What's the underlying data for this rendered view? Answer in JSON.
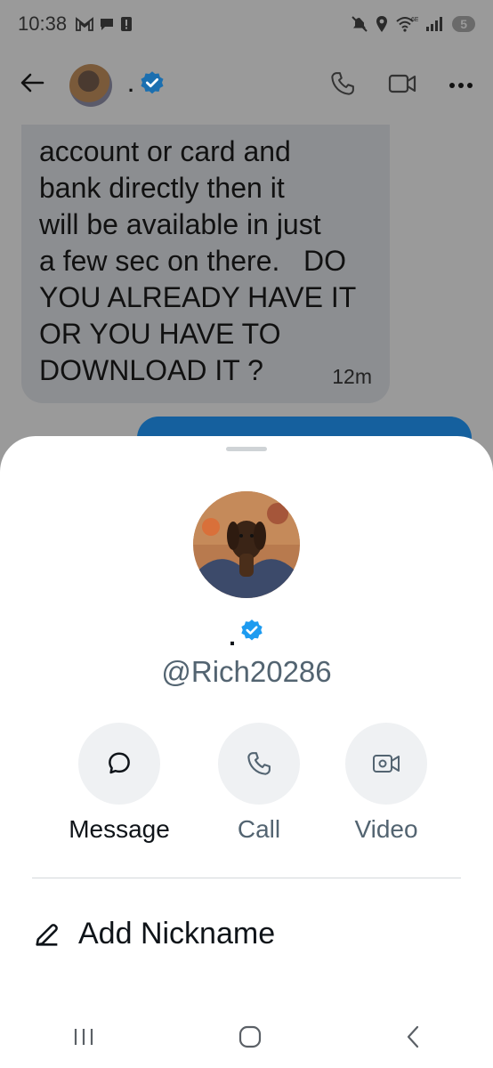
{
  "status_bar": {
    "time": "10:38",
    "left_icons": [
      "gmail-icon",
      "chat-icon",
      "alert-icon"
    ],
    "right_icons": [
      "mute-icon",
      "location-icon",
      "wifi-6e-icon",
      "signal-icon"
    ],
    "battery": "5"
  },
  "chat_header": {
    "name": ".",
    "verified": true
  },
  "message": {
    "text": "account or card and\nbank directly then it\nwill be available in just\na few sec on there.   DO\nYOU ALREADY HAVE IT\nOR YOU HAVE TO\nDOWNLOAD IT ?",
    "time": "12m"
  },
  "sheet": {
    "display_name": ".",
    "handle": "@Rich20286",
    "actions": [
      {
        "label": "Message",
        "icon": "message-icon"
      },
      {
        "label": "Call",
        "icon": "phone-icon"
      },
      {
        "label": "Video",
        "icon": "video-icon"
      }
    ],
    "nickname_label": "Add Nickname"
  },
  "colors": {
    "verified_blue": "#1d9bf0",
    "sent_bubble": "#15609e",
    "secondary_text": "#536471"
  }
}
